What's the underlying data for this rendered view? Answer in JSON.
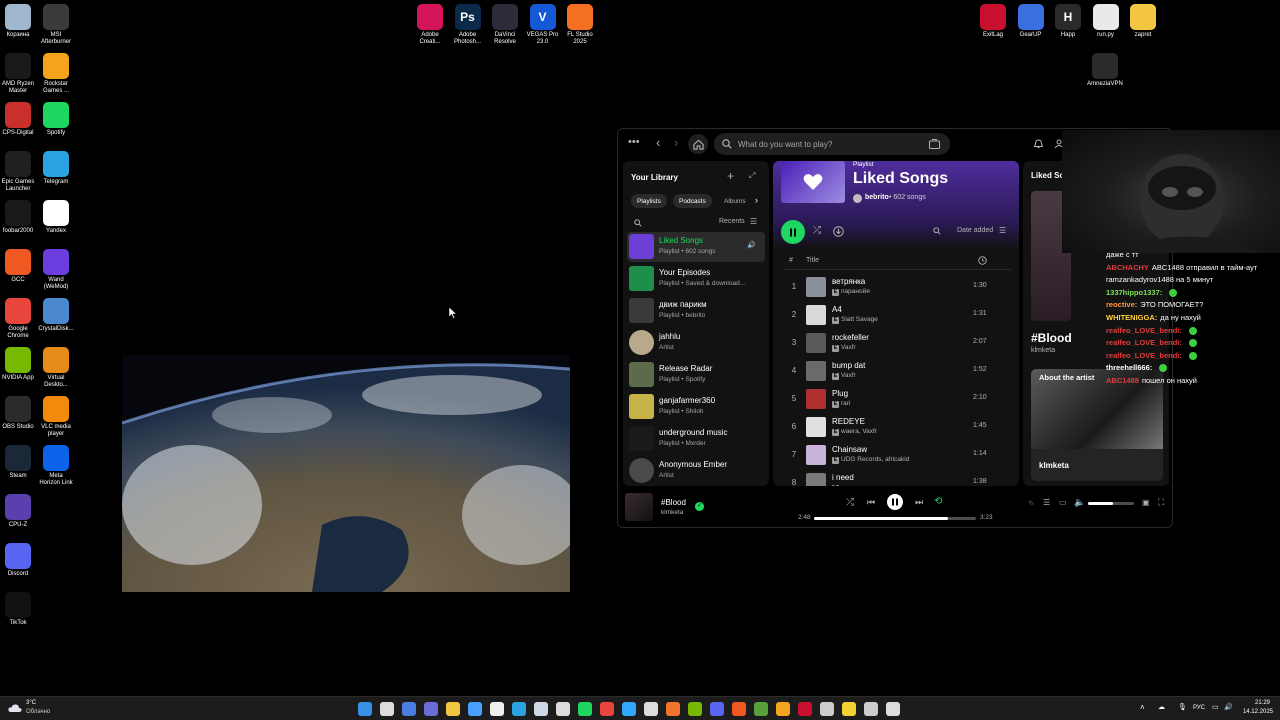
{
  "desktop": {
    "icons_left": [
      {
        "label": "Корзина",
        "icon": "recycle-bin-icon",
        "color": "#9fb6cf"
      },
      {
        "label": "MSI\nAfterburner",
        "icon": "msi-afterburner-icon",
        "color": "#3a3a3a"
      },
      {
        "label": "AMD Ryzen\nMaster",
        "icon": "amd-ryzen-icon",
        "color": "#1a1a1a"
      },
      {
        "label": "Rockstar\nGames ...",
        "icon": "rockstar-icon",
        "color": "#f4a31c"
      },
      {
        "label": "CPS-Digital",
        "icon": "cps-digital-icon",
        "color": "#c9302c"
      },
      {
        "label": "Spotify",
        "icon": "spotify-icon",
        "color": "#1ed760"
      },
      {
        "label": "Epic Games\nLauncher",
        "icon": "epic-games-icon",
        "color": "#202020"
      },
      {
        "label": "Telegram",
        "icon": "telegram-icon",
        "color": "#2aa3e0"
      },
      {
        "label": "foobar2000",
        "icon": "foobar-icon",
        "color": "#1a1a1a"
      },
      {
        "label": "Yandex",
        "icon": "yandex-icon",
        "color": "#ffffff"
      },
      {
        "label": "GCC",
        "icon": "gcc-icon",
        "color": "#f05a22"
      },
      {
        "label": "Wand\n(WeMod)",
        "icon": "wand-icon",
        "color": "#6c3ee0"
      },
      {
        "label": "Google\nChrome",
        "icon": "chrome-icon",
        "color": "#e8453c"
      },
      {
        "label": "CrystalDisk...",
        "icon": "crystaldisk-icon",
        "color": "#4a88d0"
      },
      {
        "label": "NVIDIA App",
        "icon": "nvidia-icon",
        "color": "#76b900"
      },
      {
        "label": "Virtual\nDeskto...",
        "icon": "virtual-desktop-icon",
        "color": "#e58a1b"
      },
      {
        "label": "OBS Studio",
        "icon": "obs-icon",
        "color": "#2b2b2b"
      },
      {
        "label": "VLC media\nplayer",
        "icon": "vlc-icon",
        "color": "#f28a0b"
      },
      {
        "label": "Steam",
        "icon": "steam-icon",
        "color": "#1b2838"
      },
      {
        "label": "Meta\nHorizon Link",
        "icon": "meta-icon",
        "color": "#0a63e8"
      },
      {
        "label": "CPU-Z",
        "icon": "cpu-z-icon",
        "color": "#5a3fae"
      },
      {
        "label": "Discord",
        "icon": "discord-icon",
        "color": "#5865f2"
      },
      {
        "label": "TikTok",
        "icon": "tiktok-icon",
        "color": "#111111"
      }
    ],
    "icons_top": [
      {
        "label": "Adobe\nCreati...",
        "icon": "adobe-cc-icon",
        "color": "#d4145a"
      },
      {
        "label": "Adobe\nPhotosh...",
        "icon": "photoshop-icon",
        "color": "#0b2a4a",
        "glyph": "Ps"
      },
      {
        "label": "DaVinci\nResolve",
        "icon": "davinci-icon",
        "color": "#2b2b3a"
      },
      {
        "label": "VEGAS Pro\n23.0",
        "icon": "vegas-icon",
        "color": "#1458d6",
        "glyph": "V"
      },
      {
        "label": "FL Studio\n2025",
        "icon": "fl-studio-icon",
        "color": "#f37022"
      }
    ],
    "icons_right": [
      {
        "label": "ExitLag",
        "icon": "exitlag-icon",
        "color": "#c8102e"
      },
      {
        "label": "GearUP",
        "icon": "gearup-icon",
        "color": "#3b6fe0"
      },
      {
        "label": "Happ",
        "icon": "happ-icon",
        "color": "#2a2a2a",
        "glyph": "H"
      },
      {
        "label": "run.py",
        "icon": "python-file-icon",
        "color": "#e9e9e9"
      },
      {
        "label": "zapret",
        "icon": "folder-icon",
        "color": "#f2c641"
      },
      {
        "label": "AmneziaVPN",
        "icon": "amneziavpn-icon",
        "color": "#2b2b2b"
      }
    ]
  },
  "spotify": {
    "search_placeholder": "What do you want to play?",
    "library": {
      "title": "Your Library",
      "filters": [
        "Playlists",
        "Podcasts",
        "Albums"
      ],
      "sort": "Recents",
      "items": [
        {
          "name": "Liked Songs",
          "sub": "Playlist • 602 songs",
          "color": "#6b3fd6",
          "active": true
        },
        {
          "name": "Your Episodes",
          "sub": "Playlist • Saved & download...",
          "color": "#1e8f4a"
        },
        {
          "name": "движ парикм",
          "sub": "Playlist • bebrito",
          "color": "#3a3a3a"
        },
        {
          "name": "jahhlu",
          "sub": "Artist",
          "color": "#b8a98a",
          "round": true
        },
        {
          "name": "Release Radar",
          "sub": "Playlist • Spotify",
          "color": "#5c6b4a"
        },
        {
          "name": "ganjafarmer360",
          "sub": "Playlist • Shiloh",
          "color": "#c7b24a"
        },
        {
          "name": "underground music",
          "sub": "Playlist • Mxrder",
          "color": "#1a1a1a"
        },
        {
          "name": "Anonymous Ember",
          "sub": "Artist",
          "color": "#4a4a4a",
          "round": true
        }
      ]
    },
    "playlist": {
      "kind": "Playlist",
      "title": "Liked Songs",
      "owner": "bebrito",
      "count": "602 songs",
      "sort": "Date added",
      "col_title": "Title",
      "tracks": [
        {
          "n": "1",
          "title": "ветрянка",
          "artist": "паранойя",
          "dur": "1:30",
          "color": "#8a8f9a"
        },
        {
          "n": "2",
          "title": "A4",
          "artist": "Slatt Savage",
          "dur": "1:31",
          "color": "#d9d9d9"
        },
        {
          "n": "3",
          "title": "rockefeller",
          "artist": "Vaxfr",
          "dur": "2:07",
          "color": "#5a5a5a"
        },
        {
          "n": "4",
          "title": "bump dat",
          "artist": "Vaxfr",
          "dur": "1:52",
          "color": "#6a6a6a"
        },
        {
          "n": "5",
          "title": "Plug",
          "artist": "rari",
          "dur": "2:10",
          "color": "#b03030"
        },
        {
          "n": "6",
          "title": "REDEYE",
          "artist": "waera, Vaxfr",
          "dur": "1:45",
          "color": "#e0e0e0"
        },
        {
          "n": "7",
          "title": "Chainsaw",
          "artist": "UDG Records, africakid",
          "dur": "1:14",
          "color": "#c9b3d9"
        },
        {
          "n": "8",
          "title": "i need",
          "artist": "",
          "dur": "1:38",
          "color": "#7a7a7a"
        }
      ]
    },
    "right_panel": {
      "header": "Liked Son",
      "song": "#Blood",
      "artist": "klmketa",
      "about": "About the artist",
      "about_artist": "klmketa"
    },
    "now_playing": {
      "title": "#Blood",
      "artist": "klmketa",
      "elapsed": "2:48",
      "total": "3:23",
      "progress": 0.83,
      "volume": 0.55
    }
  },
  "chat": [
    {
      "user": "",
      "msg": "даже с тт",
      "color": "#ffffff"
    },
    {
      "user": "ABCHACHY",
      "msg": "ABC1488 отправил в тайм-аут",
      "color": "#e23b3b"
    },
    {
      "user": "",
      "msg": "ramzankadyrov1488 на 5 минут",
      "color": "#ffffff"
    },
    {
      "user": "1337hippo1337:",
      "msg": "",
      "color": "#7ce15a"
    },
    {
      "user": "reoctive:",
      "msg": "ЭТО ПОМОГАЕТ?",
      "color": "#ff9a3c"
    },
    {
      "user": "WHITENIGGA:",
      "msg": "да ну нахуй",
      "color": "#ffd23c"
    },
    {
      "user": "realfeo_LOVE_bendi:",
      "msg": "",
      "color": "#e23b3b"
    },
    {
      "user": "realfeo_LOVE_bendi:",
      "msg": "",
      "color": "#e23b3b"
    },
    {
      "user": "realfeo_LOVE_bendi:",
      "msg": "",
      "color": "#e23b3b"
    },
    {
      "user": "threehell666:",
      "msg": "",
      "color": "#ffffff"
    },
    {
      "user": "ABC1488",
      "msg": "пошел он нахуй",
      "color": "#e23b3b"
    }
  ],
  "taskbar": {
    "weather_temp": "3°C",
    "weather_desc": "Облачно",
    "lang": "РУС",
    "time": "21:29",
    "date": "14.12.2025",
    "apps": [
      {
        "icon": "start-icon",
        "color": "#3a8fe8"
      },
      {
        "icon": "search-icon",
        "color": "#dddddd"
      },
      {
        "icon": "task-view-icon",
        "color": "#4a7de0"
      },
      {
        "icon": "widgets-icon",
        "color": "#6b6bd8"
      },
      {
        "icon": "file-explorer-icon",
        "color": "#f2c641"
      },
      {
        "icon": "media-icon",
        "color": "#4aa0ff"
      },
      {
        "icon": "store-icon",
        "color": "#eeeeee"
      },
      {
        "icon": "telegram-icon",
        "color": "#2aa3e0"
      },
      {
        "icon": "steam-icon",
        "color": "#cfd8e6"
      },
      {
        "icon": "settings-icon",
        "color": "#dddddd"
      },
      {
        "icon": "spotify-icon",
        "color": "#1ed760"
      },
      {
        "icon": "chrome-icon",
        "color": "#e8453c"
      },
      {
        "icon": "photoshop-icon",
        "color": "#31a8ff"
      },
      {
        "icon": "obs-icon",
        "color": "#dddddd"
      },
      {
        "icon": "firefox-icon",
        "color": "#f2752b"
      },
      {
        "icon": "nvidia-icon",
        "color": "#76b900"
      },
      {
        "icon": "discord-icon",
        "color": "#5865f2"
      },
      {
        "icon": "gcc-icon",
        "color": "#f05a22"
      },
      {
        "icon": "minecraft-icon",
        "color": "#5aa03a"
      },
      {
        "icon": "rockstar-icon",
        "color": "#f4a31c"
      },
      {
        "icon": "exitlag-icon",
        "color": "#c8102e"
      },
      {
        "icon": "happ-icon",
        "color": "#cccccc"
      },
      {
        "icon": "sticky-icon",
        "color": "#f2d230"
      },
      {
        "icon": "terminal-icon",
        "color": "#cccccc"
      },
      {
        "icon": "tools-icon",
        "color": "#dddddd"
      }
    ]
  }
}
